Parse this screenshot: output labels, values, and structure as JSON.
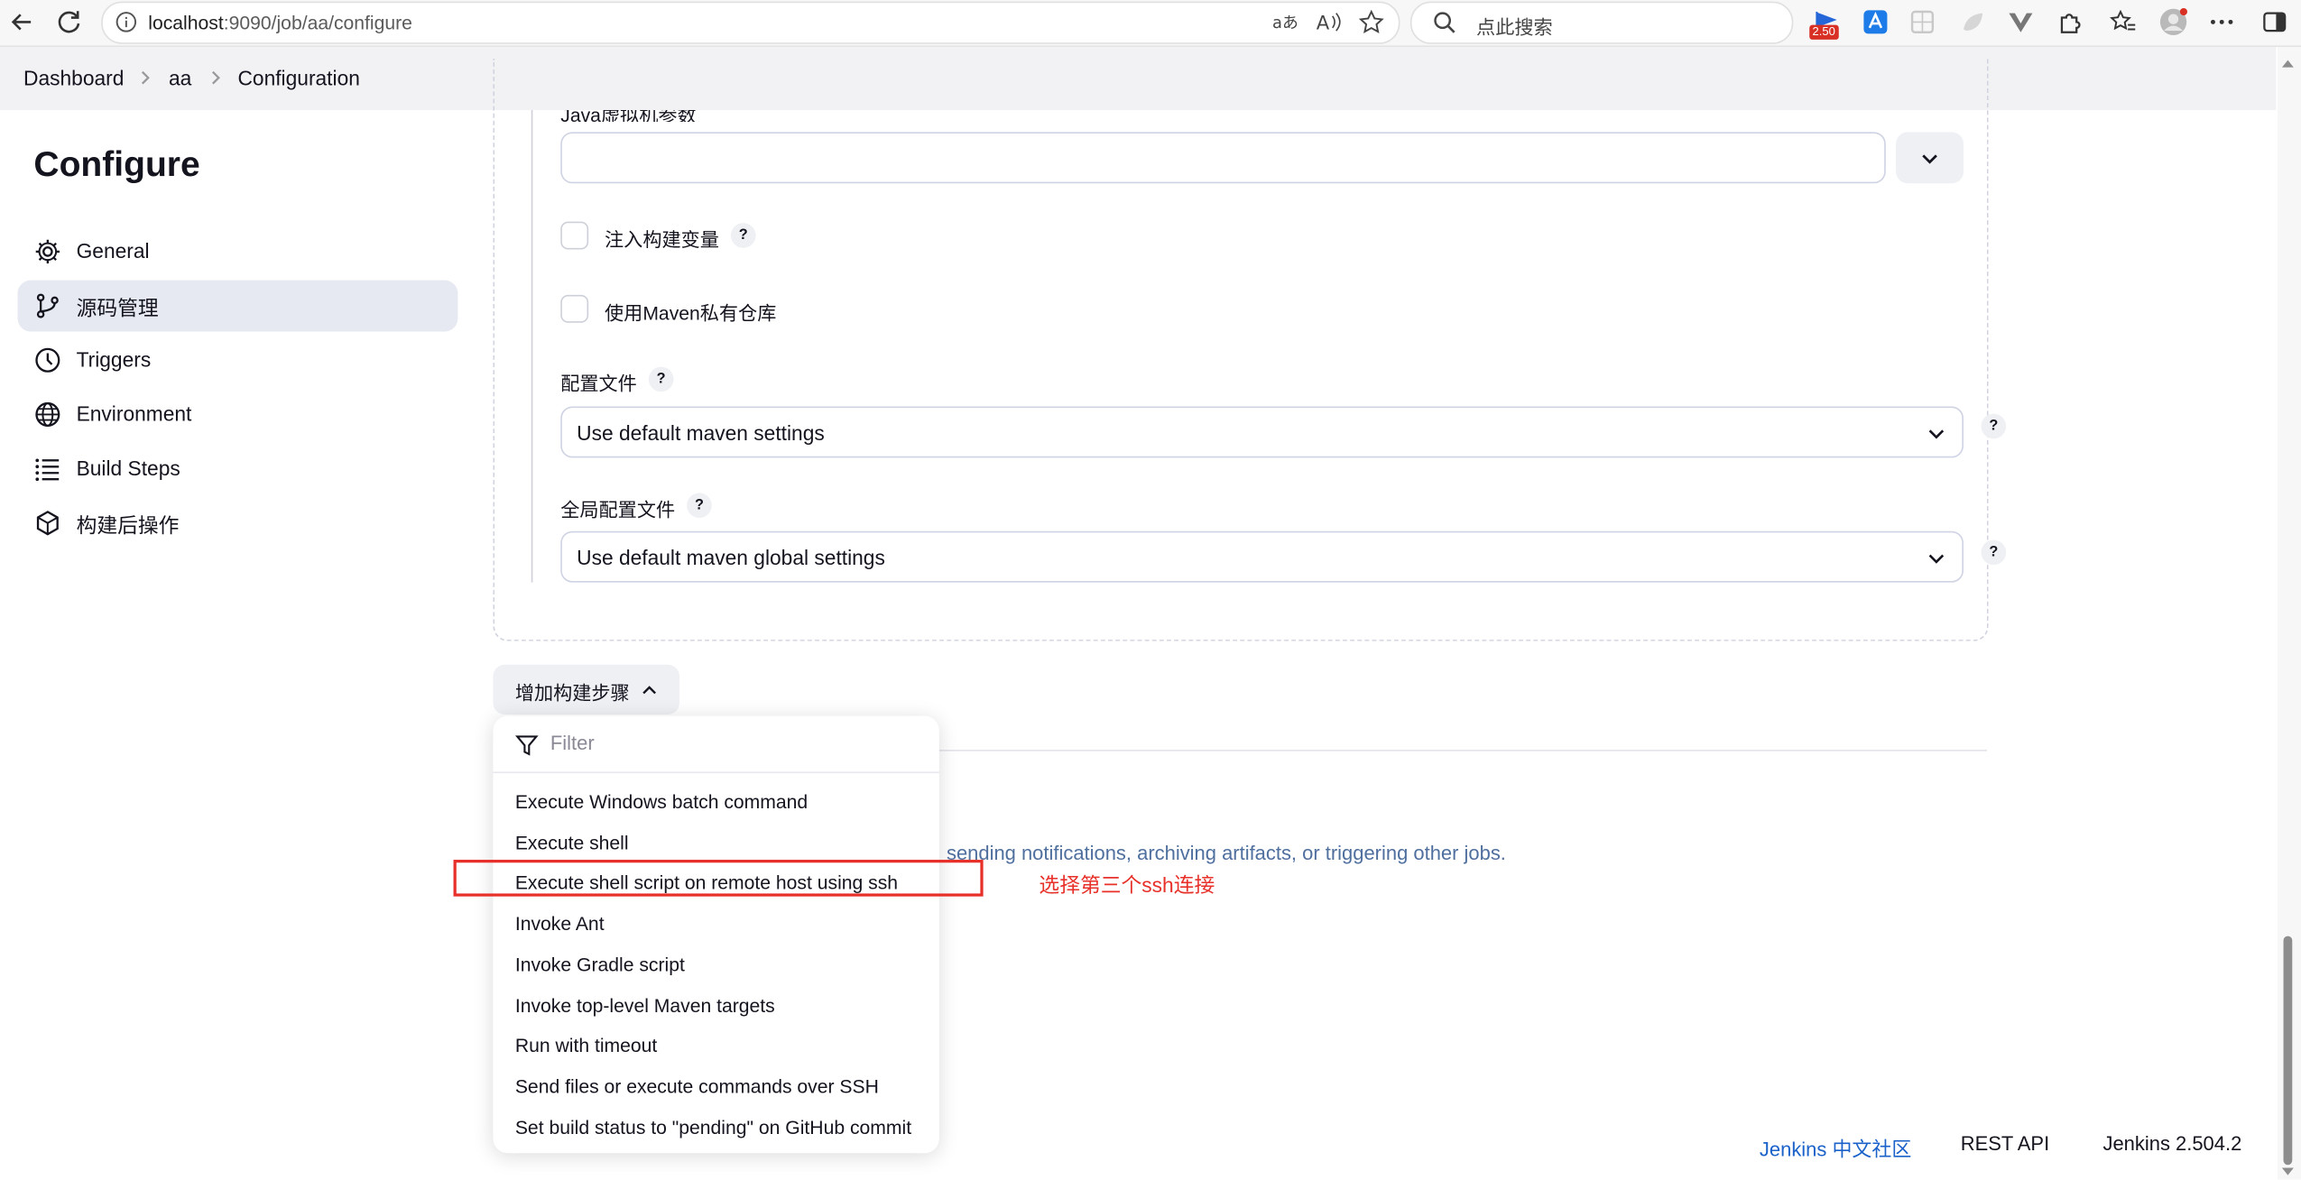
{
  "browser": {
    "url_host": "localhost",
    "url_rest": ":9090/job/aa/configure",
    "search_placeholder": "点此搜索",
    "ext_badge": "2.50"
  },
  "breadcrumb": {
    "items": [
      "Dashboard",
      "aa",
      "Configuration"
    ]
  },
  "sidebar": {
    "title": "Configure",
    "items": [
      {
        "label": "General",
        "icon": "gear-icon"
      },
      {
        "label": "源码管理",
        "icon": "branch-icon",
        "active": true
      },
      {
        "label": "Triggers",
        "icon": "clock-icon"
      },
      {
        "label": "Environment",
        "icon": "globe-icon"
      },
      {
        "label": "Build Steps",
        "icon": "list-icon"
      },
      {
        "label": "构建后操作",
        "icon": "cube-icon"
      }
    ]
  },
  "config": {
    "jvm_label": "Java虚拟机参数",
    "inject_vars_label": "注入构建变量",
    "private_repo_label": "使用Maven私有仓库",
    "settings_label": "配置文件",
    "settings_value": "Use default maven settings",
    "global_settings_label": "全局配置文件",
    "global_settings_value": "Use default maven global settings",
    "help_glyph": "?"
  },
  "add_step": {
    "label": "增加构建步骤",
    "filter_placeholder": "Filter",
    "items": [
      "Execute Windows batch command",
      "Execute shell",
      "Execute shell script on remote host using ssh",
      "Invoke Ant",
      "Invoke Gradle script",
      "Invoke top-level Maven targets",
      "Run with timeout",
      "Send files or execute commands over SSH",
      "Set build status to \"pending\" on GitHub commit"
    ]
  },
  "post_build_description": "sending notifications, archiving artifacts, or triggering other jobs.",
  "annotation": "选择第三个ssh连接",
  "footer": {
    "community": "Jenkins 中文社区",
    "rest_api": "REST API",
    "version": "Jenkins 2.504.2"
  },
  "colors": {
    "accent_red": "#e8302a",
    "link_blue": "#1a62c9",
    "muted_blue": "#4f6f9f",
    "active_bg": "#e6e9f1"
  }
}
